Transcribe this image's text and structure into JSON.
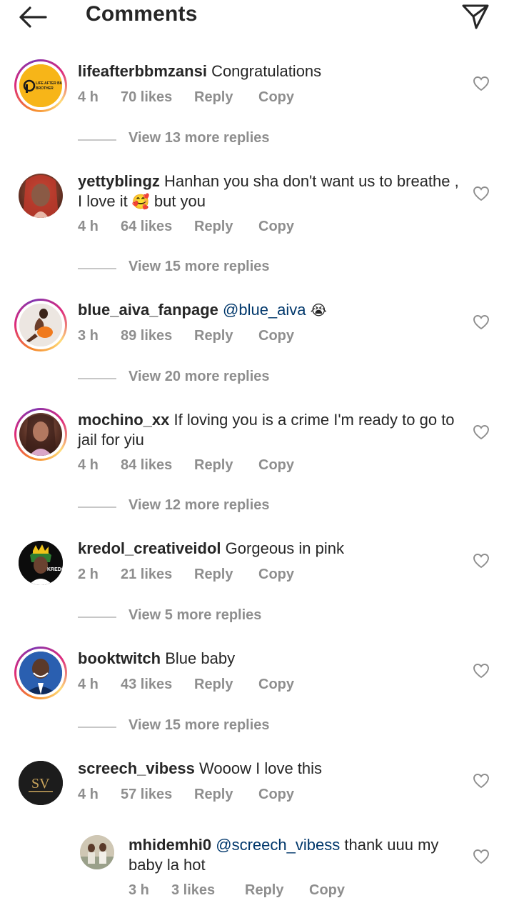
{
  "header": {
    "title": "Comments"
  },
  "comments": [
    {
      "username": "lifeafterbbmzansi",
      "text": "Congratulations",
      "time": "4 h",
      "likes": "70 likes",
      "reply": "Reply",
      "copy": "Copy",
      "view_more": "View 13 more replies",
      "logo_text": "LIFE AFTER BIG BROTHER"
    },
    {
      "username": "yettyblingz",
      "text": "Hanhan you sha don't want us to breathe , I love it",
      "emoji": "🥰",
      "text_after": "but you",
      "time": "4 h",
      "likes": "64 likes",
      "reply": "Reply",
      "copy": "Copy",
      "view_more": "View 15 more replies"
    },
    {
      "username": "blue_aiva_fanpage",
      "mention": "@blue_aiva",
      "emoji": "😭",
      "time": "3 h",
      "likes": "89 likes",
      "reply": "Reply",
      "copy": "Copy",
      "view_more": "View 20 more replies"
    },
    {
      "username": "mochino_xx",
      "text": "If loving you is a crime I'm ready to go to jail for yiu",
      "time": "4 h",
      "likes": "84 likes",
      "reply": "Reply",
      "copy": "Copy",
      "view_more": "View 12 more replies"
    },
    {
      "username": "kredol_creativeidol",
      "text": "Gorgeous in pink",
      "time": "2 h",
      "likes": "21 likes",
      "reply": "Reply",
      "copy": "Copy",
      "view_more": "View 5 more replies"
    },
    {
      "username": "booktwitch",
      "text": "Blue baby",
      "time": "4 h",
      "likes": "43 likes",
      "reply": "Reply",
      "copy": "Copy",
      "view_more": "View 15 more replies"
    },
    {
      "username": "screech_vibess",
      "text": "Wooow I love this",
      "time": "4 h",
      "likes": "57 likes",
      "reply": "Reply",
      "copy": "Copy",
      "logo_text": "SV"
    }
  ],
  "reply_comment": {
    "username": "mhidemhi0",
    "mention": "@screech_vibess",
    "text": "thank uuu my baby la hot",
    "time": "3 h",
    "likes": "3 likes",
    "reply": "Reply",
    "copy": "Copy"
  },
  "colors": {
    "text": "#262626",
    "secondary": "#8e8e8e",
    "mention": "#00376b",
    "divider": "#c7c7c7",
    "background": "#ffffff"
  },
  "icons": {
    "back": "arrow-left-icon",
    "send": "paper-plane-icon",
    "like": "heart-outline-icon"
  }
}
